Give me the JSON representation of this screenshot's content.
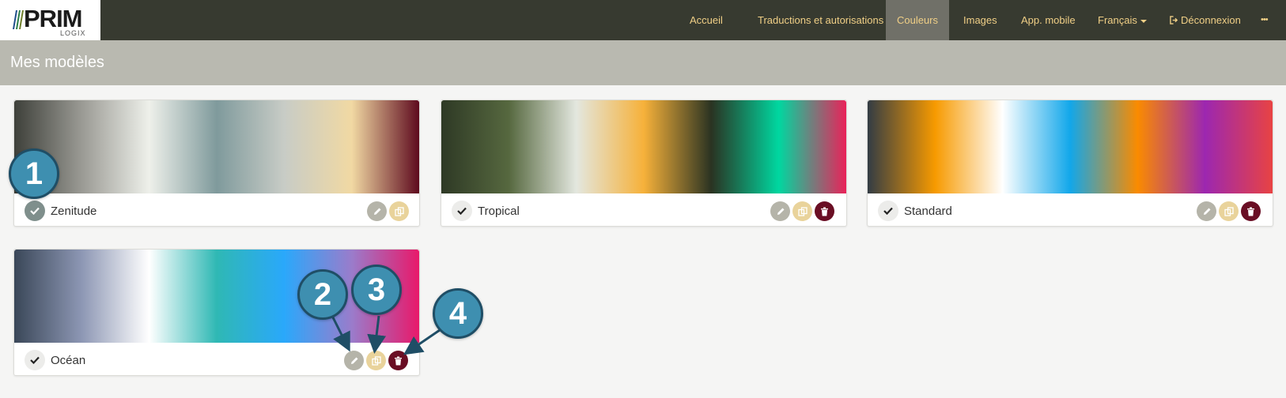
{
  "brand": {
    "name": "PRIM",
    "sub": "LOGIX"
  },
  "nav": {
    "items": [
      {
        "label": "Accueil",
        "active": false
      },
      {
        "label": "Traductions et autorisations",
        "active": false
      },
      {
        "label": "Couleurs",
        "active": true
      },
      {
        "label": "Images",
        "active": false
      },
      {
        "label": "App. mobile",
        "active": false
      },
      {
        "label": "Français",
        "active": false
      },
      {
        "label": "Déconnexion",
        "active": false
      },
      {
        "label": "•••",
        "active": false
      }
    ]
  },
  "page": {
    "title": "Mes modèles"
  },
  "models": [
    {
      "name": "Zenitude",
      "selected": true,
      "deletable": false,
      "colors": [
        "#3e403a",
        "#9a9a94",
        "#eef0ea",
        "#7f9a9c",
        "#c8ccc6",
        "#f1d9a3",
        "#5e0a1e"
      ]
    },
    {
      "name": "Tropical",
      "selected": false,
      "deletable": true,
      "colors": [
        "#2e3925",
        "#56683f",
        "#e3e7df",
        "#f6b13a",
        "#2a3322",
        "#00d7a0",
        "#ea2259"
      ]
    },
    {
      "name": "Standard",
      "selected": false,
      "deletable": true,
      "colors": [
        "#333c44",
        "#f79a00",
        "#ffffff",
        "#12a7ea",
        "#fa8b00",
        "#9c27b0",
        "#e84343"
      ]
    },
    {
      "name": "Océan",
      "selected": false,
      "deletable": true,
      "colors": [
        "#3a4758",
        "#8d97b4",
        "#ffffff",
        "#2fb8b4",
        "#2aa8fb",
        "#9a7ccb",
        "#e8196a"
      ]
    }
  ],
  "callouts": [
    "1",
    "2",
    "3",
    "4"
  ],
  "colors": {
    "navbar": "#373a30",
    "nav_text": "#f0cf86",
    "subheader": "#b9b9b0",
    "edit_button": "#b5b4a9",
    "copy_button": "#e9d39b",
    "delete_button": "#6a0e24",
    "callout": "#3e8fb0"
  },
  "icons": {
    "check": "check-icon",
    "edit": "pencil-icon",
    "copy": "copy-icon",
    "delete": "trash-icon",
    "logout": "sign-out-icon",
    "dropdown": "chevron-down-icon"
  }
}
